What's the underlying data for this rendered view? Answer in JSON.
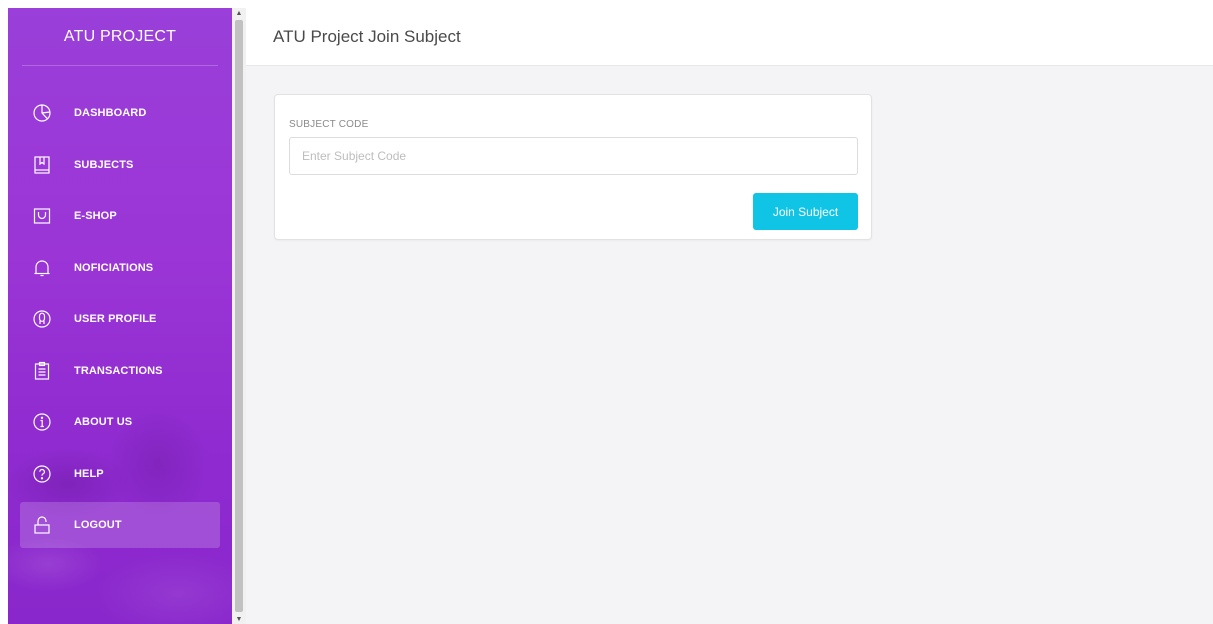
{
  "app": {
    "brand": "ATU PROJECT"
  },
  "page": {
    "title": "ATU Project Join Subject"
  },
  "sidebar": {
    "items": [
      {
        "label": "DASHBOARD",
        "icon": "pie-chart-icon"
      },
      {
        "label": "SUBJECTS",
        "icon": "book-icon"
      },
      {
        "label": "E-SHOP",
        "icon": "shopping-bag-icon"
      },
      {
        "label": "NOFICIATIONS",
        "icon": "bell-icon"
      },
      {
        "label": "USER PROFILE",
        "icon": "user-icon"
      },
      {
        "label": "TRANSACTIONS",
        "icon": "clipboard-icon"
      },
      {
        "label": "ABOUT US",
        "icon": "info-icon"
      },
      {
        "label": "HELP",
        "icon": "help-icon"
      },
      {
        "label": "LOGOUT",
        "icon": "unlock-icon",
        "active": true
      }
    ]
  },
  "form": {
    "subject_code_label": "SUBJECT CODE",
    "subject_code_placeholder": "Enter Subject Code",
    "subject_code_value": "",
    "join_button_label": "Join Subject"
  },
  "colors": {
    "sidebar_gradient_top": "#9a3fd9",
    "sidebar_gradient_bottom": "#8a27cc",
    "accent_button": "#10c4e6",
    "main_background": "#f4f4f6"
  }
}
